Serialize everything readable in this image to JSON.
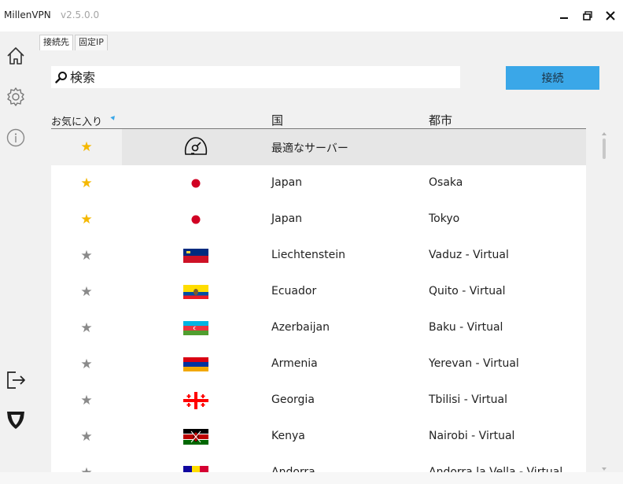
{
  "window": {
    "app_name": "MillenVPN",
    "version": "v2.5.0.0"
  },
  "sidebar": {
    "items": [
      {
        "icon": "home-icon"
      },
      {
        "icon": "gear-icon"
      },
      {
        "icon": "info-icon"
      },
      {
        "icon": "logout-icon"
      },
      {
        "icon": "shield-logo-icon"
      }
    ]
  },
  "tabs": [
    {
      "label": "接続先",
      "active": true
    },
    {
      "label": "固定IP",
      "active": false
    }
  ],
  "search": {
    "placeholder": "検索",
    "value": ""
  },
  "connect_label": "接続",
  "columns": {
    "favorites": "お気に入り",
    "country": "国",
    "city": "都市"
  },
  "rows": [
    {
      "favorite": true,
      "flag": "speedometer",
      "country": "最適なサーバー",
      "city": "",
      "selected": true
    },
    {
      "favorite": true,
      "flag": "jp",
      "country": "Japan",
      "city": "Osaka"
    },
    {
      "favorite": true,
      "flag": "jp",
      "country": "Japan",
      "city": "Tokyo"
    },
    {
      "favorite": false,
      "flag": "li",
      "country": "Liechtenstein",
      "city": "Vaduz - Virtual"
    },
    {
      "favorite": false,
      "flag": "ec",
      "country": "Ecuador",
      "city": "Quito - Virtual"
    },
    {
      "favorite": false,
      "flag": "az",
      "country": "Azerbaijan",
      "city": "Baku - Virtual"
    },
    {
      "favorite": false,
      "flag": "am",
      "country": "Armenia",
      "city": "Yerevan - Virtual"
    },
    {
      "favorite": false,
      "flag": "ge",
      "country": "Georgia",
      "city": "Tbilisi - Virtual"
    },
    {
      "favorite": false,
      "flag": "ke",
      "country": "Kenya",
      "city": "Nairobi - Virtual"
    },
    {
      "favorite": false,
      "flag": "ad",
      "country": "Andorra",
      "city": "Andorra la Vella - Virtual"
    }
  ],
  "colors": {
    "accent": "#3aa7e8",
    "star_on": "#f5b800",
    "star_off": "#8a8a8a"
  }
}
